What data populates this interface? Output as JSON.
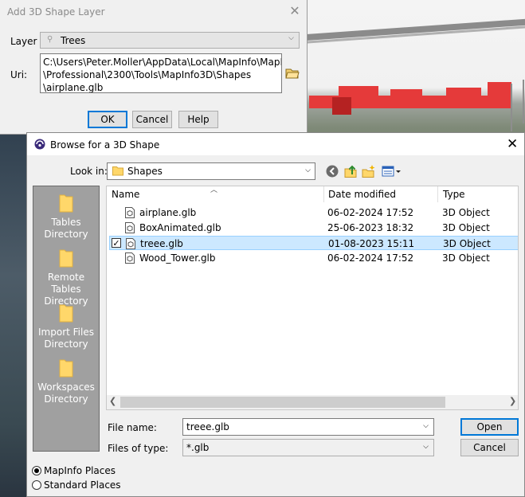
{
  "add_dialog": {
    "title": "Add 3D Shape Layer",
    "layer_label": "Layer",
    "layer_value": "Trees",
    "uri_label": "Uri:",
    "uri_value": "C:\\Users\\Peter.Moller\\AppData\\Local\\MapInfo\\MapInfo\n\\Professional\\2300\\Tools\\MapInfo3D\\Shapes\n\\airplane.glb",
    "ok_label": "OK",
    "cancel_label": "Cancel",
    "help_label": "Help"
  },
  "browse_dialog": {
    "title": "Browse for a 3D Shape",
    "look_in_label": "Look in:",
    "look_in_value": "Shapes",
    "places": [
      {
        "line1": "Tables",
        "line2": "Directory"
      },
      {
        "line1": "Remote Tables",
        "line2": "Directory"
      },
      {
        "line1": "Import Files",
        "line2": "Directory"
      },
      {
        "line1": "Workspaces",
        "line2": "Directory"
      }
    ],
    "columns": {
      "name": "Name",
      "date": "Date modified",
      "type": "Type"
    },
    "files": [
      {
        "name": "airplane.glb",
        "date": "06-02-2024 17:52",
        "type": "3D Object"
      },
      {
        "name": "BoxAnimated.glb",
        "date": "25-06-2023 18:32",
        "type": "3D Object"
      },
      {
        "name": "treee.glb",
        "date": "01-08-2023 15:11",
        "type": "3D Object",
        "selected": true
      },
      {
        "name": "Wood_Tower.glb",
        "date": "06-02-2024 17:52",
        "type": "3D Object"
      }
    ],
    "file_name_label": "File name:",
    "file_name_value": "treee.glb",
    "file_type_label": "Files of type:",
    "file_type_value": "*.glb",
    "open_label": "Open",
    "cancel_label": "Cancel",
    "radio_mapinfo": "MapInfo Places",
    "radio_standard": "Standard Places",
    "selected_radio": "MapInfo Places"
  },
  "icons": [
    "close-icon",
    "pin-icon",
    "open-folder-icon",
    "app-icon",
    "folder-icon",
    "back-icon",
    "up-folder-icon",
    "new-folder-icon",
    "view-menu-icon",
    "file-3d-icon",
    "chevron-down-icon"
  ]
}
